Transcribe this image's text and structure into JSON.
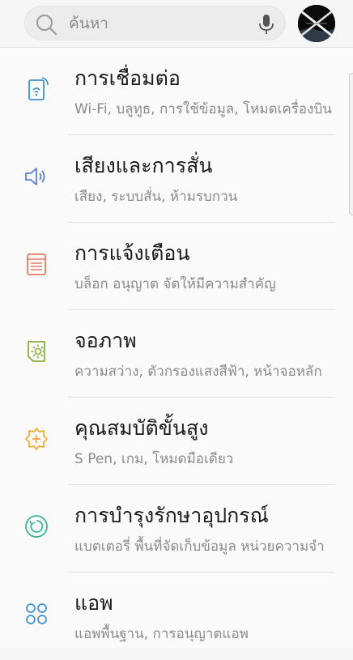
{
  "search": {
    "placeholder": "ค้นหา"
  },
  "colors": {
    "connections": "#3d8fd4",
    "sounds": "#5c7fd0",
    "notifications": "#e87a66",
    "display": "#8cae3a",
    "advanced": "#f0a830",
    "maintenance": "#3bb89a",
    "apps": "#3d8fd4"
  },
  "settings": [
    {
      "icon": "connections-icon",
      "title": "การเชื่อมต่อ",
      "subtitle": "Wi-Fi, บลูทูธ, การใช้ข้อมูล, โหมดเครื่องบิน"
    },
    {
      "icon": "sound-icon",
      "title": "เสียงและการสั่น",
      "subtitle": "เสียง, ระบบสั่น, ห้ามรบกวน"
    },
    {
      "icon": "notifications-icon",
      "title": "การแจ้งเตือน",
      "subtitle": "บล็อก อนุญาต จัดให้มีความสำคัญ"
    },
    {
      "icon": "display-icon",
      "title": "จอภาพ",
      "subtitle": "ความสว่าง, ตัวกรองแสงสีฟ้า, หน้าจอหลัก"
    },
    {
      "icon": "advanced-features-icon",
      "title": "คุณสมบัติขั้นสูง",
      "subtitle": "S Pen, เกม, โหมดมือเดียว"
    },
    {
      "icon": "device-maintenance-icon",
      "title": "การบำรุงรักษาอุปกรณ์",
      "subtitle": "แบตเตอรี่ พื้นที่จัดเก็บข้อมูล หน่วยความจำ"
    },
    {
      "icon": "apps-icon",
      "title": "แอพ",
      "subtitle": "แอพพื้นฐาน, การอนุญาตแอพ"
    }
  ]
}
